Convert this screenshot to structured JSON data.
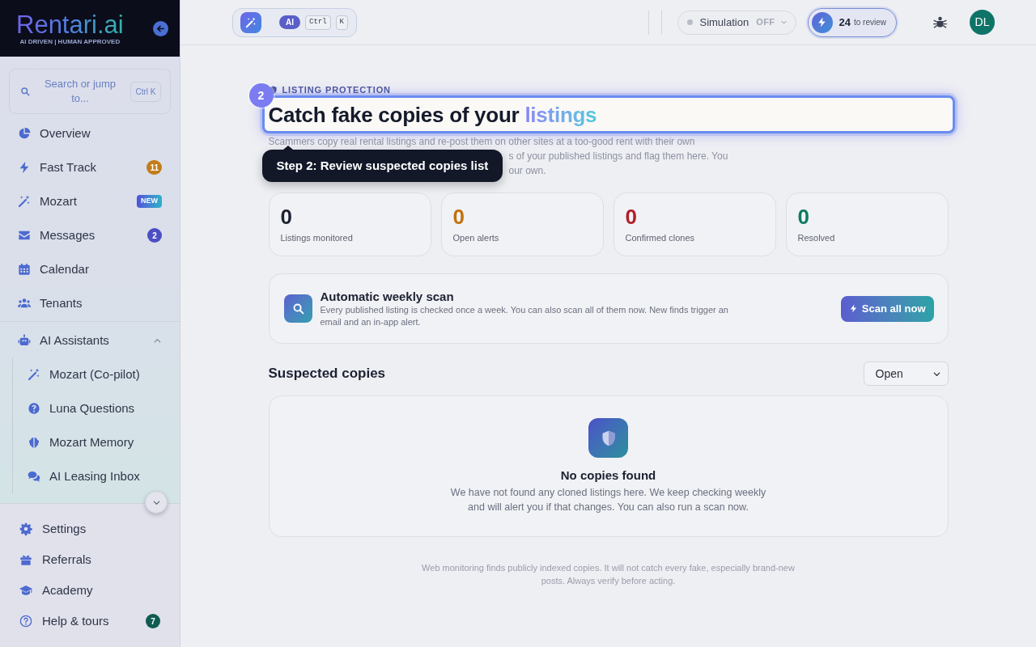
{
  "sidebar": {
    "logo": "Rentari.ai",
    "tagline": "AI DRIVEN | HUMAN APPROVED",
    "search": {
      "label": "Search or jump to...",
      "shortcut": "Ctrl K"
    },
    "nav": [
      {
        "label": "Overview"
      },
      {
        "label": "Fast Track",
        "badge": {
          "kind": "count",
          "text": "11",
          "color": "#c27c1a"
        }
      },
      {
        "label": "Mozart",
        "badge": {
          "kind": "tag",
          "text": "NEW"
        }
      },
      {
        "label": "Messages",
        "badge": {
          "kind": "count",
          "text": "2",
          "color": "#4c4fc2"
        }
      },
      {
        "label": "Calendar"
      },
      {
        "label": "Tenants"
      },
      {
        "label": "AI Assistants",
        "expanded": true,
        "children": [
          {
            "label": "Mozart (Co-pilot)"
          },
          {
            "label": "Luna Questions"
          },
          {
            "label": "Mozart Memory"
          },
          {
            "label": "AI Leasing Inbox"
          }
        ]
      }
    ],
    "footer_nav": [
      {
        "label": "Settings"
      },
      {
        "label": "Referrals"
      },
      {
        "label": "Academy"
      },
      {
        "label": "Help & tours",
        "badge": {
          "kind": "count",
          "text": "7",
          "color": "#0f5c52"
        }
      }
    ]
  },
  "top_bar": {
    "command_bar": {
      "ai_label": "AI",
      "keys": [
        "Ctrl",
        "K"
      ]
    },
    "simulation": {
      "label": "Simulation",
      "value": "OFF",
      "on": false
    },
    "review": {
      "count": "24",
      "label": "to review"
    },
    "avatar": "DL"
  },
  "page": {
    "eyebrow": "LISTING PROTECTION",
    "title": "Catch fake copies of your",
    "title_highlight": "listings",
    "description_lines": [
      "Scammers copy real rental listings and re-post them on other sites at a too-good rent with their own",
      "s of your published listings and flag them here. You",
      "our own."
    ],
    "stats": [
      {
        "value": "0",
        "label": "Listings monitored",
        "color": "#1c2132"
      },
      {
        "value": "0",
        "label": "Open alerts",
        "color": "#c2700f"
      },
      {
        "value": "0",
        "label": "Confirmed clones",
        "color": "#b11f2a"
      },
      {
        "value": "0",
        "label": "Resolved",
        "color": "#0c7a64"
      }
    ],
    "scan": {
      "title": "Automatic weekly scan",
      "description": "Every published listing is checked once a week. You can also scan all of them now. New finds trigger an email and an in-app alert.",
      "button": "Scan all now"
    },
    "suspected": {
      "title": "Suspected copies",
      "filter": "Open",
      "empty_title": "No copies found",
      "empty_description": "We have not found any cloned listings here. We keep checking weekly and will alert you if that changes. You can also run a scan now."
    },
    "footnote": "Web monitoring finds publicly indexed copies. It will not catch every fake, especially brand-new posts. Always verify before acting."
  },
  "tour": {
    "step": "2",
    "tooltip": "Step 2: Review suspected copies list"
  }
}
